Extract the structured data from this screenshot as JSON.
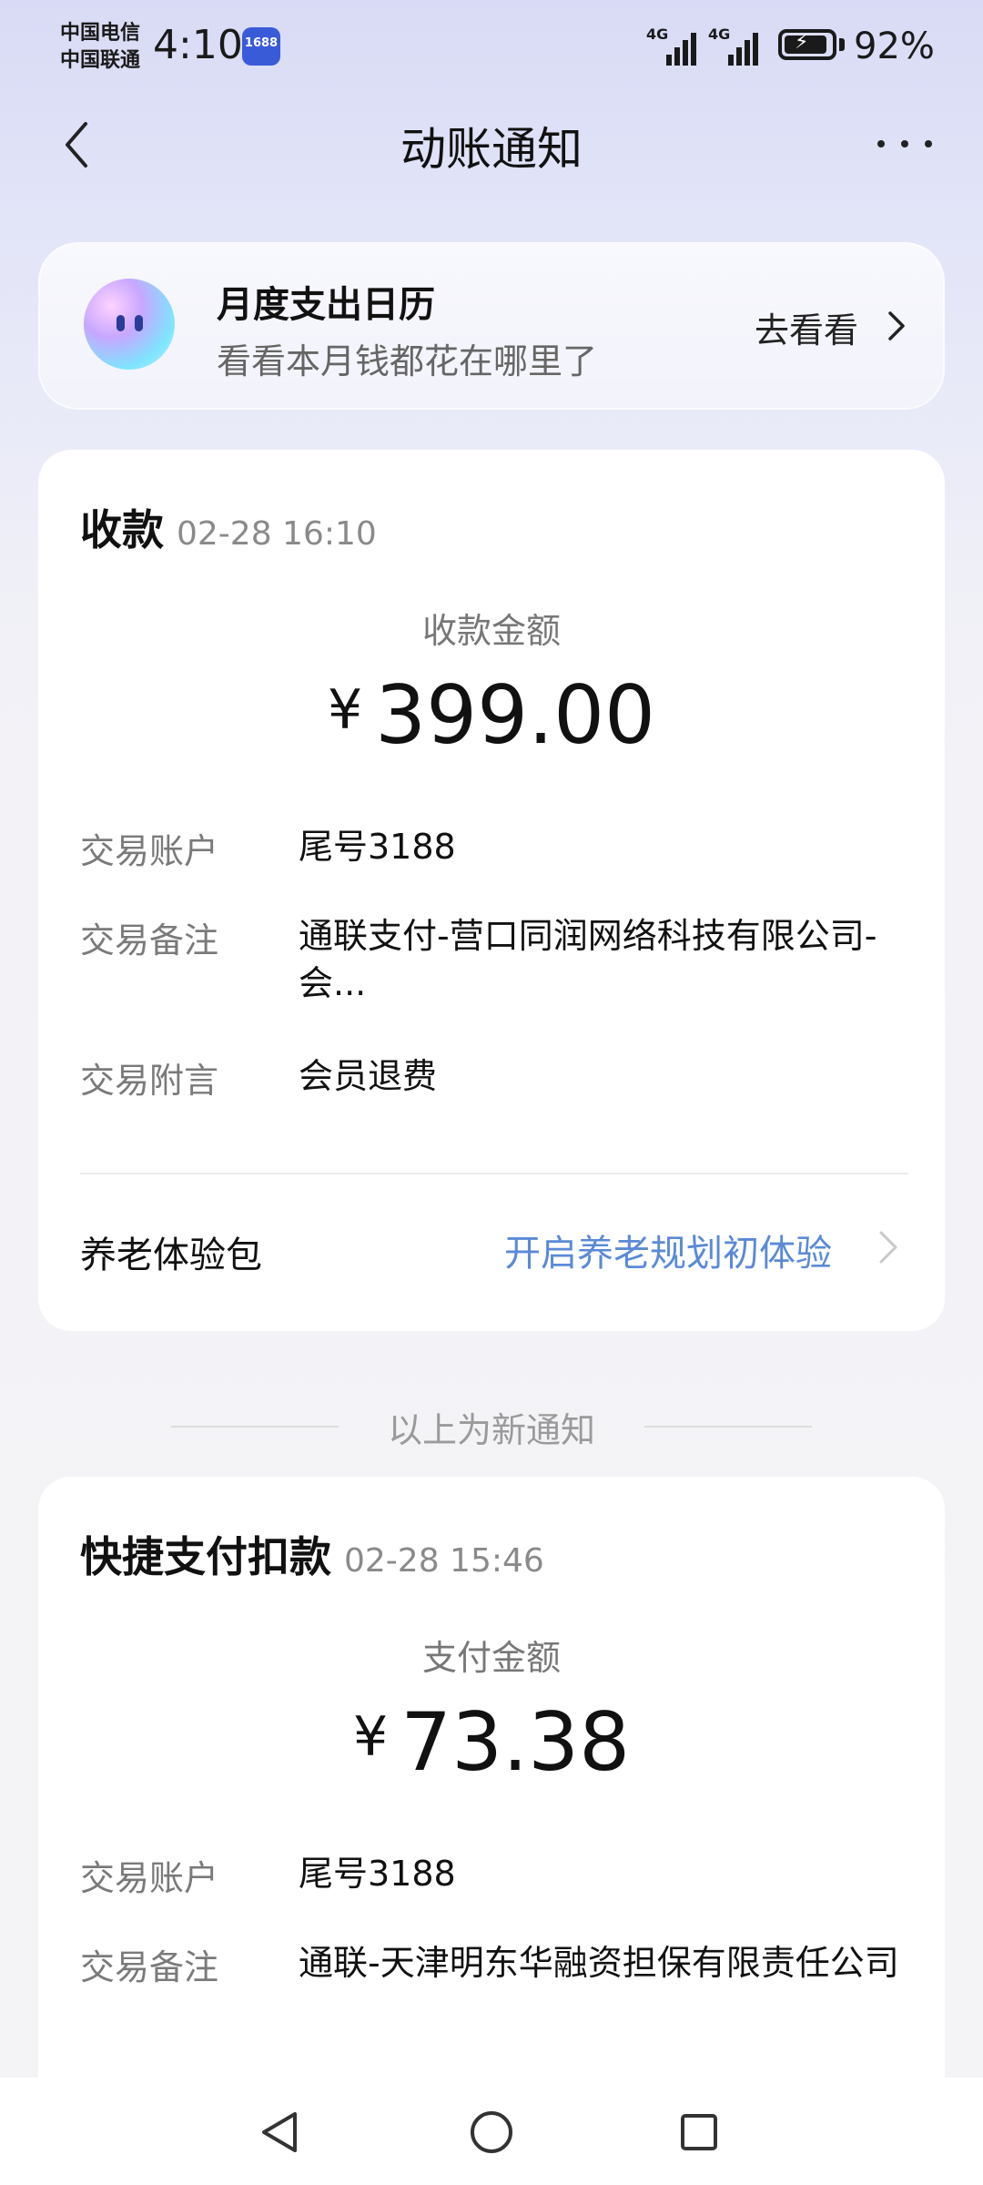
{
  "status_bar": {
    "carrier1": "中国电信",
    "carrier2": "中国联通",
    "time": "4:10",
    "app_badge": "1688",
    "signal1": "4G",
    "signal2": "4G",
    "battery_level": 0.92,
    "battery": "92%"
  },
  "header": {
    "title": "动账通知",
    "back_icon": "chevron-left-icon",
    "more_icon": "more-dots-icon"
  },
  "promo": {
    "title": "月度支出日历",
    "subtitle": "看看本月钱都花在哪里了",
    "action": "去看看"
  },
  "cards": [
    {
      "type": "收款",
      "time": "02-28 16:10",
      "amount_label": "收款金额",
      "currency": "¥",
      "amount": "399.00",
      "rows": [
        {
          "key": "交易账户",
          "value": "尾号3188"
        },
        {
          "key": "交易备注",
          "value": "通联支付-营口同润网络科技有限公司-会..."
        },
        {
          "key": "交易附言",
          "value": "会员退费"
        }
      ],
      "pension": {
        "label": "养老体验包",
        "link": "开启养老规划初体验"
      }
    },
    {
      "type": "快捷支付扣款",
      "time": "02-28 15:46",
      "amount_label": "支付金额",
      "currency": "¥",
      "amount": "73.38",
      "rows": [
        {
          "key": "交易账户",
          "value": "尾号3188"
        },
        {
          "key": "交易备注",
          "value": "通联-天津明东华融资担保有限责任公司"
        }
      ]
    }
  ],
  "separator": "以上为新通知",
  "nav": {
    "back_icon": "triangle-back-icon",
    "home_icon": "circle-home-icon",
    "recents_icon": "square-recents-icon"
  },
  "colors": {
    "link": "#5b8ad6",
    "background_top": "#d9dbf6"
  }
}
